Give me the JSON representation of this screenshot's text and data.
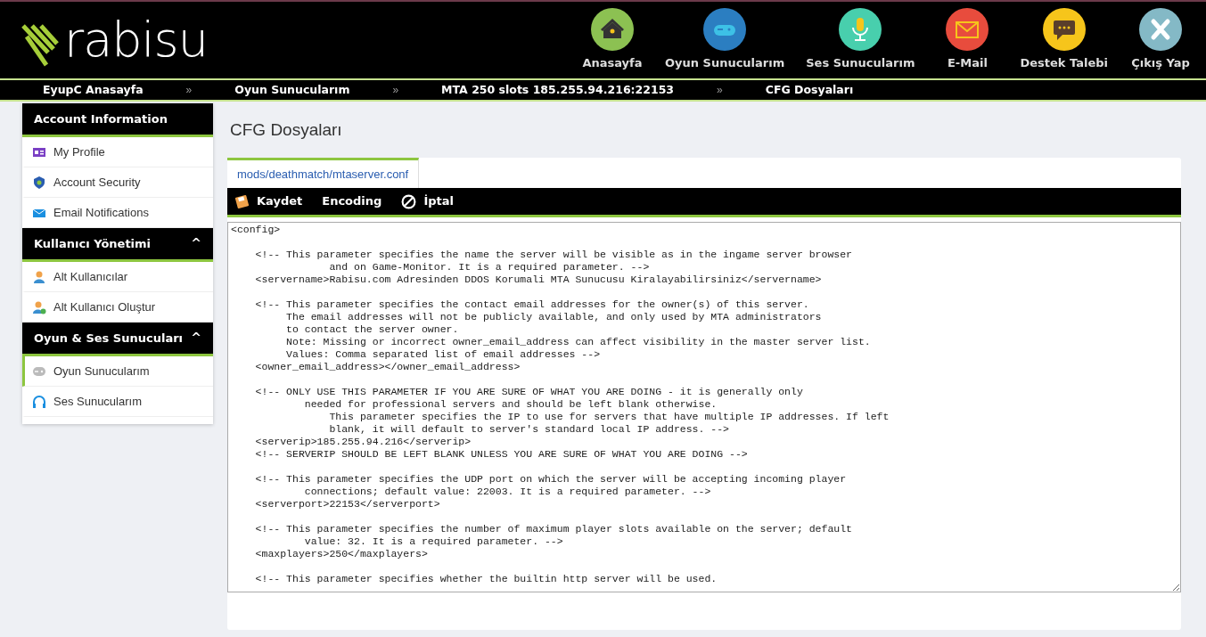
{
  "logo": {
    "text": "rabisu"
  },
  "top_nav": [
    {
      "label": "Anasayfa",
      "kind": "home",
      "color": "#8cc152"
    },
    {
      "label": "Oyun Sunucularım",
      "kind": "gamepad",
      "color": "#2b7ec1"
    },
    {
      "label": "Ses Sunucularım",
      "kind": "mic",
      "color": "#48cfad"
    },
    {
      "label": "E-Mail",
      "kind": "mail",
      "color": "#e84c3d"
    },
    {
      "label": "Destek Talebi",
      "kind": "chat",
      "color": "#f6c51b"
    },
    {
      "label": "Çıkış Yap",
      "kind": "close",
      "color": "#84b9c6"
    }
  ],
  "breadcrumb": [
    {
      "label": "EyupC Anasayfa",
      "separator": "»"
    },
    {
      "label": "Oyun Sunucularım",
      "separator": "»"
    },
    {
      "label": "MTA 250 slots 185.255.94.216:22153",
      "separator": "»"
    },
    {
      "label": "CFG Dosyaları"
    }
  ],
  "sidebar": [
    {
      "title": "Account Information",
      "items": [
        {
          "label": "My Profile",
          "kind": "profile",
          "selected": false
        },
        {
          "label": "Account Security",
          "kind": "shield",
          "selected": false
        },
        {
          "label": "Email Notifications",
          "kind": "envelope",
          "selected": false
        }
      ]
    },
    {
      "title": "Kullanıcı Yönetimi",
      "toggle": "^",
      "items": [
        {
          "label": "Alt Kullanıcılar",
          "kind": "user",
          "selected": false
        },
        {
          "label": "Alt Kullanıcı Oluştur",
          "kind": "user-add",
          "selected": false
        }
      ]
    },
    {
      "title": "Oyun & Ses Sunucuları",
      "toggle": "^",
      "items": [
        {
          "label": "Oyun Sunucularım",
          "kind": "gamepad",
          "selected": true
        },
        {
          "label": "Ses Sunucularım",
          "kind": "headset",
          "selected": false
        }
      ]
    }
  ],
  "page_title": "CFG Dosyaları",
  "tabs": [
    {
      "label": "mods/deathmatch/mtaserver.conf",
      "selected": true
    }
  ],
  "toolbar": [
    {
      "label": "Kaydet",
      "kind": "save"
    },
    {
      "label": "Encoding",
      "kind": "text"
    },
    {
      "label": "İptal",
      "kind": "cancel"
    }
  ],
  "editor": {
    "blocks": [
      [
        "<config>"
      ],
      [
        "    <!-- This parameter specifies the name the server will be visible as in the ingame server browser",
        "                and on Game-Monitor. It is a required parameter. -->",
        "    <servername>Rabisu.com Adresinden DDOS Korumali MTA Sunucusu Kiralayabilirsiniz</servername>"
      ],
      [
        "    <!-- This parameter specifies the contact email addresses for the owner(s) of this server.",
        "         The email addresses will not be publicly available, and only used by MTA administrators",
        "         to contact the server owner.",
        "         Note: Missing or incorrect owner_email_address can affect visibility in the master server list.",
        "         Values: Comma separated list of email addresses -->",
        "    <owner_email_address></owner_email_address>"
      ],
      [
        "    <!-- ONLY USE THIS PARAMETER IF YOU ARE SURE OF WHAT YOU ARE DOING - it is generally only",
        "            needed for professional servers and should be left blank otherwise.",
        "                This parameter specifies the IP to use for servers that have multiple IP addresses. If left",
        "                blank, it will default to server's standard local IP address. -->",
        "    <serverip>185.255.94.216</serverip>",
        "    <!-- SERVERIP SHOULD BE LEFT BLANK UNLESS YOU ARE SURE OF WHAT YOU ARE DOING -->"
      ],
      [
        "    <!-- This parameter specifies the UDP port on which the server will be accepting incoming player",
        "            connections; default value: 22003. It is a required parameter. -->",
        "    <serverport>22153</serverport>"
      ],
      [
        "    <!-- This parameter specifies the number of maximum player slots available on the server; default",
        "            value: 32. It is a required parameter. -->",
        "    <maxplayers>250</maxplayers>"
      ],
      [
        "    <!-- This parameter specifies whether the builtin http server will be used."
      ]
    ]
  }
}
